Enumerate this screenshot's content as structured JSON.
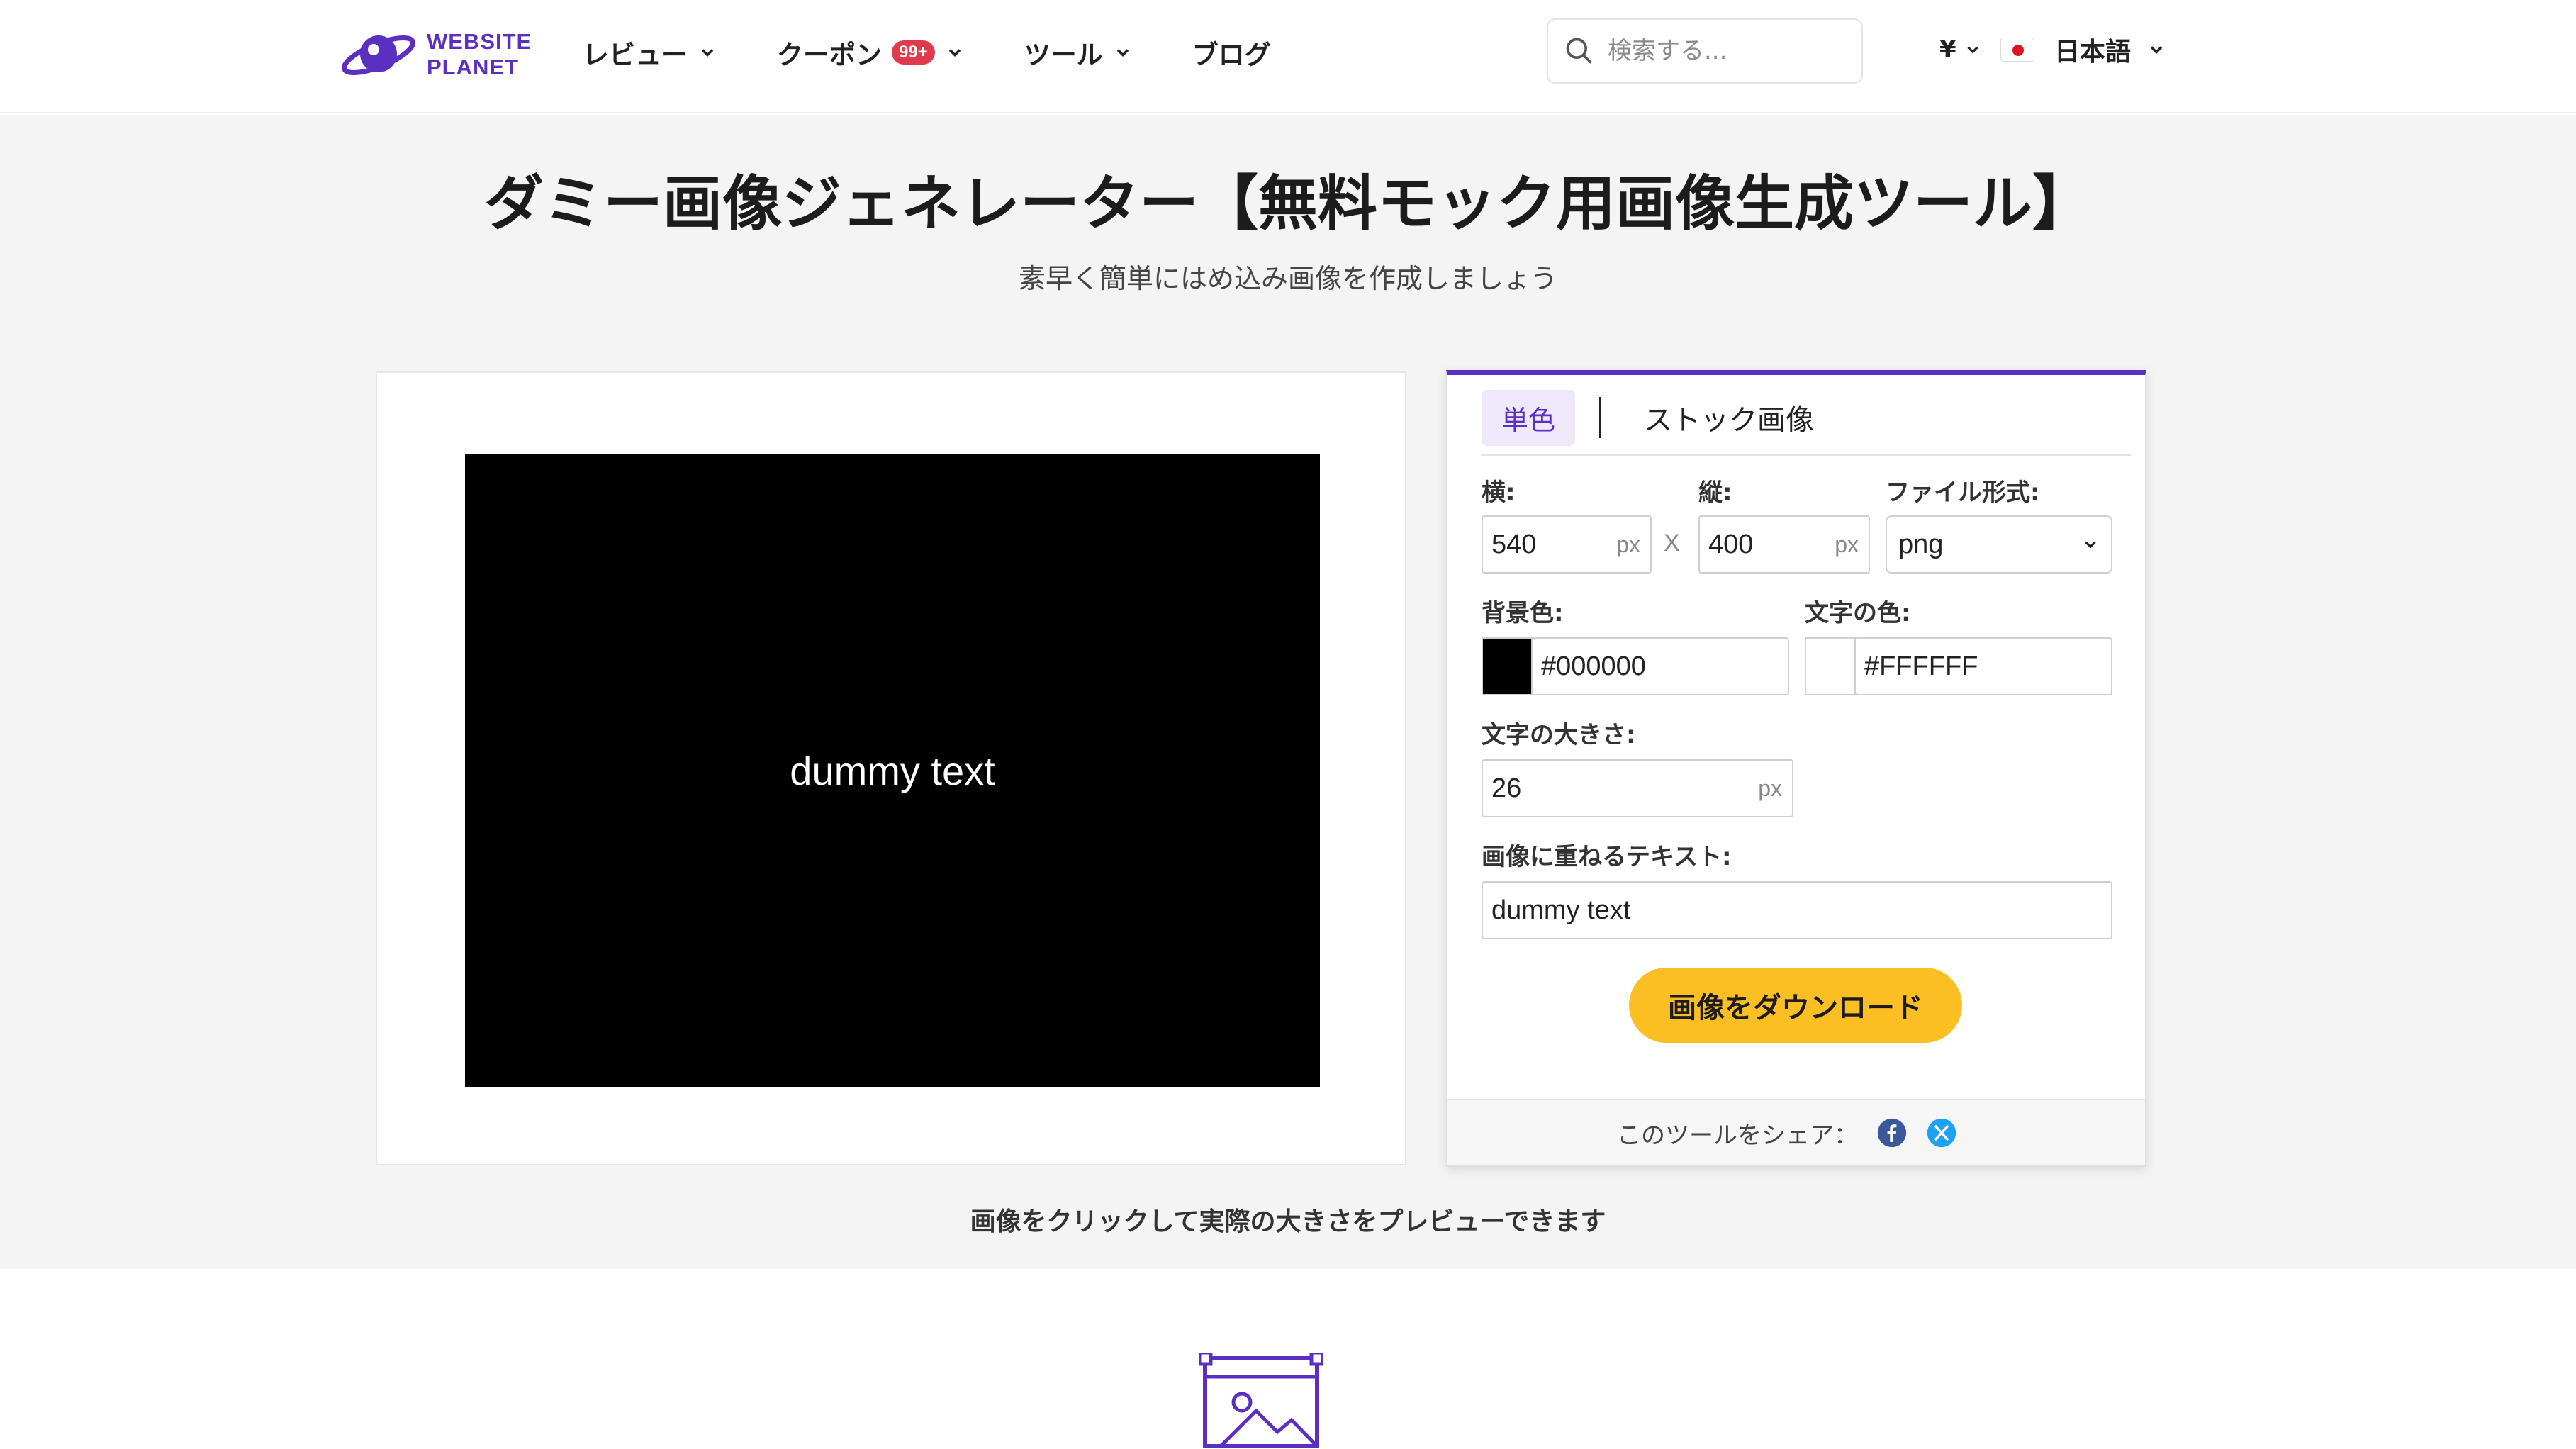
{
  "header": {
    "logo_line1": "WEBSITE",
    "logo_line2": "PLANET",
    "nav": [
      {
        "label": "レビュー"
      },
      {
        "label": "クーポン",
        "badge": "99+"
      },
      {
        "label": "ツール"
      },
      {
        "label": "ブログ"
      }
    ],
    "search_placeholder": "検索する...",
    "currency": "¥",
    "language": "日本語"
  },
  "page": {
    "title": "ダミー画像ジェネレーター【無料モック用画像生成ツール】",
    "subtitle": "素早く簡単にはめ込み画像を作成しましょう",
    "hint": "画像をクリックして実際の大きさをプレビューできます"
  },
  "preview": {
    "text": "dummy text",
    "background_color": "#000000",
    "text_color": "#FFFFFF"
  },
  "settings": {
    "tab_solid": "単色",
    "tab_stock": "ストック画像",
    "width_label": "横:",
    "width_value": "540",
    "height_label": "縦:",
    "height_value": "400",
    "unit": "px",
    "times": "X",
    "format_label": "ファイル形式:",
    "format_value": "png",
    "bg_label": "背景色:",
    "bg_value": "#000000",
    "text_color_label": "文字の色:",
    "text_color_value": "#FFFFFF",
    "font_size_label": "文字の大きさ:",
    "font_size_value": "26",
    "overlay_label": "画像に重ねるテキスト:",
    "overlay_value": "dummy text",
    "download_label": "画像をダウンロード",
    "share_label": "このツールをシェア："
  },
  "colors": {
    "brand": "#5a2fc2",
    "button": "#fbbf24",
    "badge": "#e23a4d",
    "facebook": "#3b5998",
    "x_share": "#1da1f2"
  }
}
